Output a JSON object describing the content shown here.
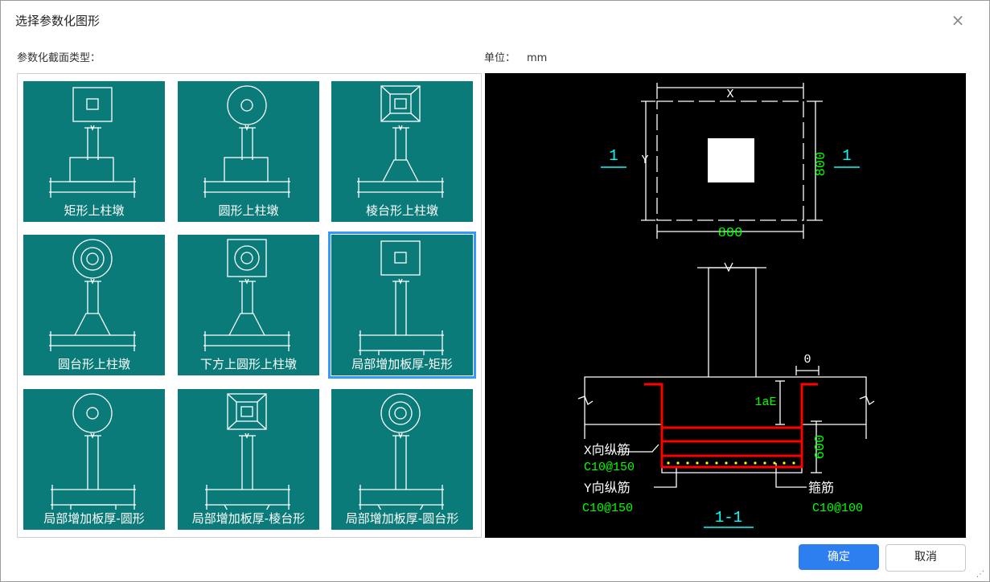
{
  "dialog": {
    "title": "选择参数化图形",
    "type_label": "参数化截面类型：",
    "unit_label": "单位：",
    "unit_value": "mm"
  },
  "shapes": [
    {
      "caption": "矩形上柱墩",
      "top": "rect-square",
      "base": "step",
      "selected": false
    },
    {
      "caption": "圆形上柱墩",
      "top": "circle",
      "base": "step",
      "selected": false
    },
    {
      "caption": "棱台形上柱墩",
      "top": "frustum",
      "base": "trapezoid",
      "selected": false
    },
    {
      "caption": "圆台形上柱墩",
      "top": "concentric",
      "base": "trapezoid",
      "selected": false
    },
    {
      "caption": "下方上圆形上柱墩",
      "top": "square-circle",
      "base": "trapezoid",
      "selected": false
    },
    {
      "caption": "局部增加板厚-矩形",
      "top": "rect-square",
      "base": "slab-rect",
      "selected": true
    },
    {
      "caption": "局部增加板厚-圆形",
      "top": "circle",
      "base": "slab-rect",
      "selected": false
    },
    {
      "caption": "局部增加板厚-棱台形",
      "top": "frustum",
      "base": "slab-trap",
      "selected": false
    },
    {
      "caption": "局部增加板厚-圆台形",
      "top": "concentric",
      "base": "slab-trap",
      "selected": false
    }
  ],
  "preview": {
    "plan_x": "X",
    "plan_y": "Y",
    "dim_width": "800",
    "dim_height": "800",
    "section_mark_left": "1",
    "section_mark_right": "1",
    "zero_label": "0",
    "anchor_label": "1aE",
    "thickness_label": "600",
    "x_bar_label": "X向纵筋",
    "x_bar_spec": "C10@150",
    "y_bar_label": "Y向纵筋",
    "y_bar_spec": "C10@150",
    "stirrup_label": "箍筋",
    "stirrup_spec": "C10@100",
    "section_title": "1-1",
    "colors": {
      "bg": "#000000",
      "line": "#ffffff",
      "dim": "#00ff00",
      "mark": "#00ffff",
      "rebar": "#ff0000",
      "dot": "#ffff00"
    }
  },
  "buttons": {
    "ok": "确定",
    "cancel": "取消"
  },
  "theme": {
    "cell_bg": "#0a7b78",
    "select": "#3399ff",
    "primary": "#2d7ff0"
  }
}
